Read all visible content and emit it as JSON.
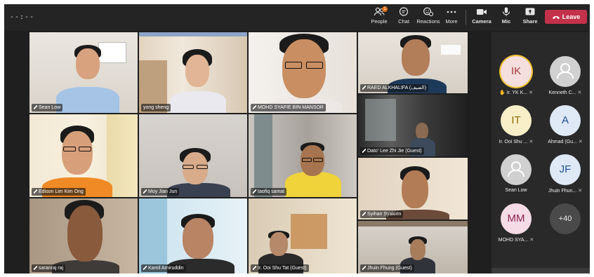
{
  "topbar": {
    "timer": "--:--",
    "people_badge": "1",
    "tools": [
      {
        "label": "People",
        "icon": "people-icon"
      },
      {
        "label": "Chat",
        "icon": "chat-icon"
      },
      {
        "label": "Reactions",
        "icon": "reactions-icon"
      },
      {
        "label": "More",
        "icon": "more-icon"
      },
      {
        "label": "Camera",
        "icon": "camera-icon"
      },
      {
        "label": "Mic",
        "icon": "mic-icon"
      },
      {
        "label": "Share",
        "icon": "share-icon"
      }
    ],
    "leave_label": "Leave",
    "leave_color": "#c4314b"
  },
  "grid": {
    "tiles": [
      {
        "name": "Sean Low"
      },
      {
        "name": "yong sheng"
      },
      {
        "name": "MOHD SYAFIE BIN MANSOR"
      },
      {
        "name": "RAED ALKHALIFA (الضيف)"
      },
      {
        "name": "Dato' Lee Zhi Jie (Guest)"
      },
      {
        "name": "Edison Lim Kim Ong"
      },
      {
        "name": "Moy Jian Jun"
      },
      {
        "name": "taofiq samat"
      },
      {
        "name": "Syihan Syakirin"
      },
      {
        "name": "saranraj raj"
      },
      {
        "name": "Kamil Amiruddin"
      },
      {
        "name": "Ir. Ooi Shu Tat (Guest)"
      },
      {
        "name": "Jhuin Fhung (Guest)"
      }
    ]
  },
  "panel": {
    "people": [
      {
        "initials": "IK",
        "name": "Ir. YK K...",
        "hand": "✋",
        "avatar_bg": "#f4dede",
        "avatar_fg": "#a4373a"
      },
      {
        "initials": "",
        "name": "Kenneth C...",
        "avatar_bg": "#d0d0d0"
      },
      {
        "initials": "IT",
        "name": "Ir. Ooi Shu ...",
        "avatar_bg": "#f8efc9",
        "avatar_fg": "#8a6d00"
      },
      {
        "initials": "A",
        "name": "Ahmad (Gu...",
        "avatar_bg": "#dfe9f6",
        "avatar_fg": "#1d4f91"
      },
      {
        "initials": "",
        "name": "Sean Low",
        "avatar_bg": "#d0d0d0"
      },
      {
        "initials": "JF",
        "name": "Jhuin Fhun...",
        "avatar_bg": "#dfe9f6",
        "avatar_fg": "#1d4f91"
      },
      {
        "initials": "MM",
        "name": "MOHD SYA...",
        "avatar_bg": "#f4dbe6",
        "avatar_fg": "#8b2252"
      },
      {
        "initials": "+40",
        "name": ""
      }
    ]
  }
}
